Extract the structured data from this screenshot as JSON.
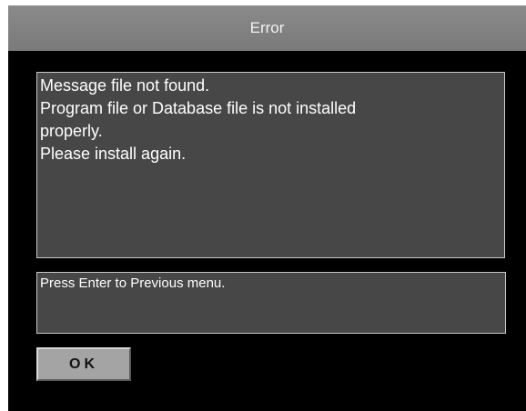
{
  "dialog": {
    "title": "Error",
    "message": "Message file not found.\nProgram file or Database file is not installed\nproperly.\nPlease install again.",
    "hint": "Press Enter to Previous menu.",
    "ok_label": "OK"
  },
  "colors": {
    "title_bar": "#7f7f7f",
    "background": "#000000",
    "box_fill": "#474747",
    "box_border": "#c9c9c9",
    "button": "#a4a4a4"
  }
}
